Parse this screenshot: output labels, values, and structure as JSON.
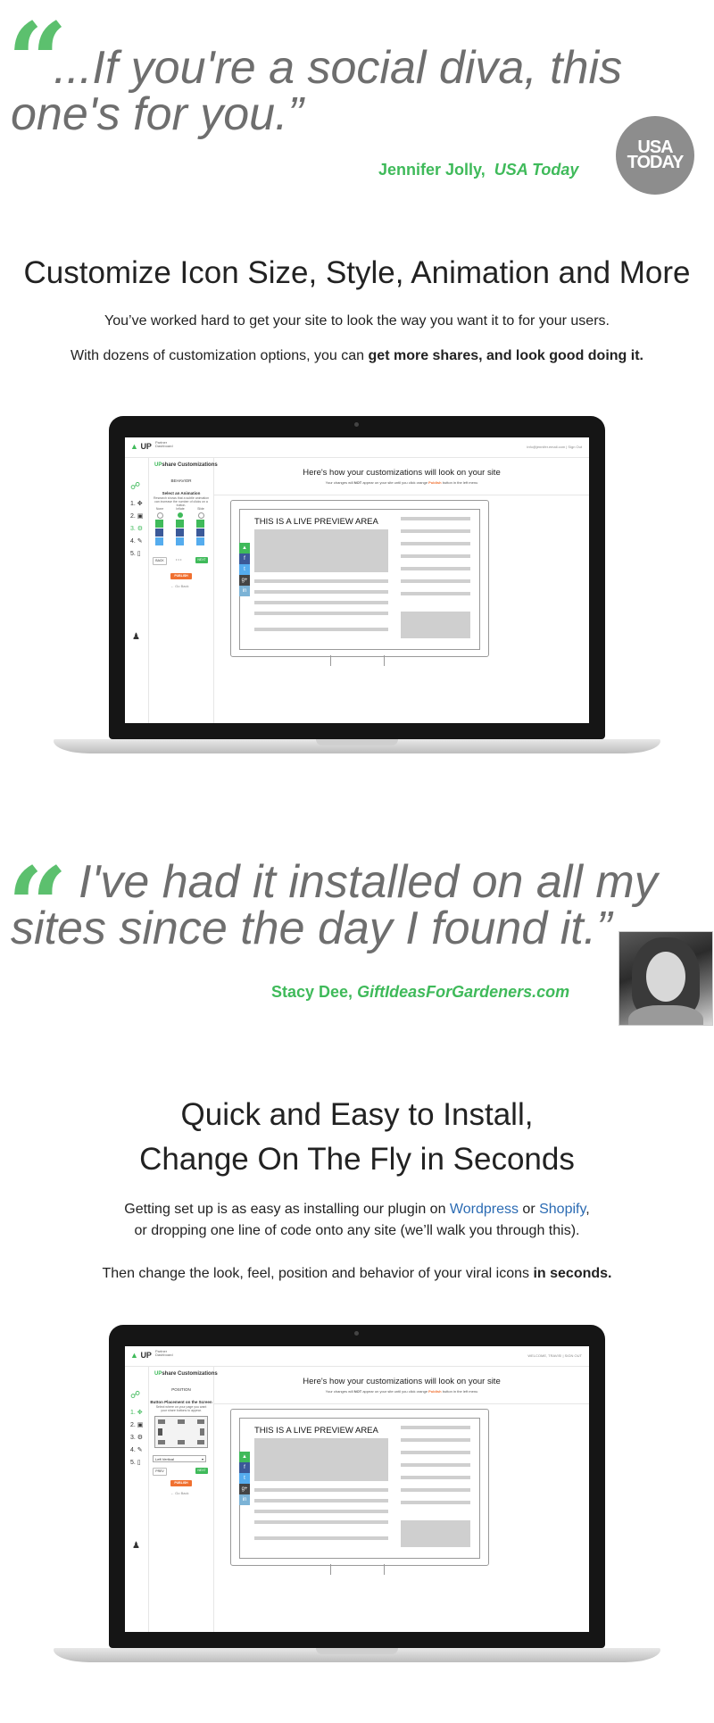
{
  "quote1": {
    "mark": "“",
    "line1": "...If you're a social diva, this",
    "line2": "one's for you.”",
    "author": "Jennifer Jolly,",
    "source": "USA Today",
    "badge_line1": "USA",
    "badge_line2": "TODAY"
  },
  "section1": {
    "heading": "Customize Icon Size, Style, Animation and More",
    "para1": "You’ve worked hard to get your site to look the way you want it to for your users.",
    "para2_start": "With dozens of customization options, you can ",
    "para2_bold": "get more shares, and look good doing it."
  },
  "laptop1": {
    "logo": "UP",
    "logo_sub1": "Partner",
    "logo_sub2": "Dashboard",
    "top_links": "info@jennifer.email.com  |  Sign Out",
    "panel_title_green": "UP",
    "panel_title": "share Customizations",
    "panel_section": "BEHAVIOR",
    "panel_label": "Select an Animation",
    "panel_hint": "Research shows that a subtle animation can increase the number of clicks on a button.",
    "opt_none": "None",
    "opt_inflate": "Inflate",
    "opt_slide": "Slide",
    "back_label": "BACK",
    "next_label": "NEXT",
    "dots": "• • •",
    "publish_label": "PUBLISH",
    "go_back": "Go Back",
    "steps": [
      "1.",
      "2.",
      "3.",
      "4.",
      "5."
    ],
    "main_heading": "Here's how your customizations will look on your site",
    "main_sub_1": "Your changes will ",
    "main_sub_not": "NOT",
    "main_sub_2": " appear on your site until you click orange ",
    "main_sub_publish": "Publish",
    "main_sub_3": " button in the left menu",
    "preview_title": "THIS IS A LIVE PREVIEW AREA"
  },
  "quote2": {
    "mark": "“",
    "line1": "I've had it installed on all my",
    "line2": "sites since the day I found it.”",
    "author": "Stacy Dee,",
    "source": "GiftIdeasForGardeners.com"
  },
  "section2": {
    "heading1": "Quick and Easy to Install,",
    "heading2": "Change On The Fly in Seconds",
    "para1_start": "Getting set up is as easy as installing our plugin on ",
    "wordpress": "Wordpress",
    "or": " or ",
    "shopify": "Shopify",
    "comma": ",",
    "para1_line2": "or dropping one line of code onto any site (we’ll walk you through this).",
    "para2_start": "Then change the look, feel, position and behavior of your viral icons ",
    "para2_bold": "in seconds."
  },
  "laptop2": {
    "logo": "UP",
    "logo_sub1": "Partner",
    "logo_sub2": "Dashboard",
    "top_links": "WELCOME, TRAVIS!  |  SIGN OUT",
    "panel_title_green": "UP",
    "panel_title": "share Customizations",
    "panel_section": "POSITION",
    "panel_label": "Button Placement on the Screen",
    "panel_hint": "Select where on your page you want your share buttons to appear.",
    "select_value": "Left Vertical",
    "prev_label": "PREV",
    "next_label": "NEXT",
    "publish_label": "PUBLISH",
    "go_back": "Go Back",
    "steps": [
      "1.",
      "2.",
      "3.",
      "4.",
      "5."
    ],
    "main_heading": "Here's how your customizations will look on your site",
    "main_sub_1": "Your changes will ",
    "main_sub_not": "NOT",
    "main_sub_2": " appear on your site until you click orange ",
    "main_sub_publish": "Publish",
    "main_sub_3": " button in the left menu",
    "preview_title": "THIS IS A LIVE PREVIEW AREA"
  },
  "colors": {
    "green": "#3fba5a",
    "quote_gray": "#6e6e6e",
    "orange": "#f07030",
    "link": "#2b6bb3"
  },
  "icons": {
    "share_bar": [
      "upshare-icon",
      "facebook-icon",
      "twitter-icon",
      "google-plus-icon",
      "linkedin-icon"
    ]
  }
}
